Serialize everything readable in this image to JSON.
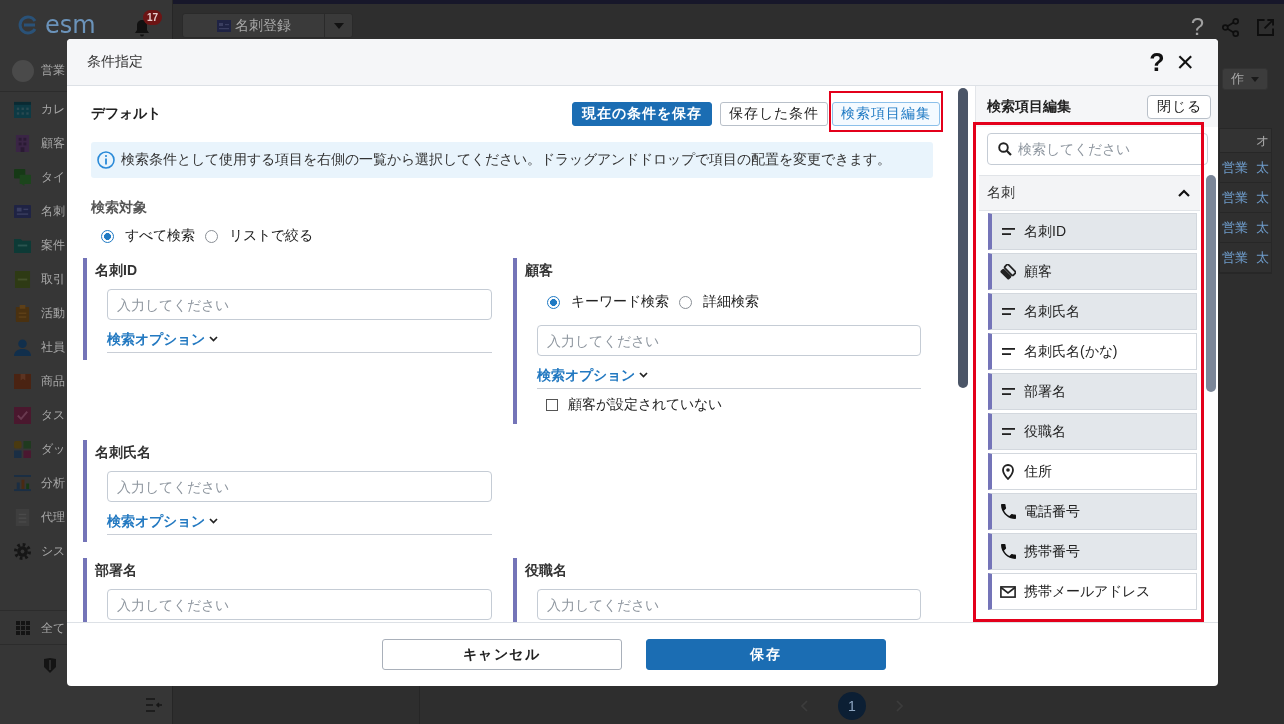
{
  "app": {
    "logo": "esm",
    "notification_count": "17",
    "register_button": "名刺登録",
    "help": "?",
    "sidebar": {
      "user": "営業",
      "items": [
        {
          "label": "カレ",
          "kind": "calendar"
        },
        {
          "label": "顧客",
          "kind": "building"
        },
        {
          "label": "タイ",
          "kind": "chat"
        },
        {
          "label": "名刺",
          "kind": "card"
        },
        {
          "label": "案件",
          "kind": "folder"
        },
        {
          "label": "取引",
          "kind": "ledger"
        },
        {
          "label": "活動",
          "kind": "clipboard"
        },
        {
          "label": "社員",
          "kind": "person"
        },
        {
          "label": "商品",
          "kind": "box"
        },
        {
          "label": "タス",
          "kind": "checkbox"
        },
        {
          "label": "ダッ",
          "kind": "tiles"
        },
        {
          "label": "分析",
          "kind": "chart"
        },
        {
          "label": "代理",
          "kind": "document"
        },
        {
          "label": "シス",
          "kind": "gear"
        }
      ],
      "all_apps": "全て"
    },
    "actions_button": "作",
    "table": {
      "column_2_heading": "オ",
      "rows": [
        [
          "営業",
          "太"
        ],
        [
          "営業",
          "太"
        ],
        [
          "営業",
          "太"
        ],
        [
          "営業",
          "太"
        ]
      ]
    },
    "pagination": [
      {
        "label": "1",
        "selected": true
      }
    ]
  },
  "dialog": {
    "title": "条件指定",
    "help": "?",
    "close": "×",
    "condition_name": "デフォルト",
    "toolbar": [
      {
        "label": "現在の条件を保存",
        "kind": "primary",
        "highlighted": false
      },
      {
        "label": "保存した条件",
        "kind": "outline",
        "highlighted": false
      },
      {
        "label": "検索項目編集",
        "kind": "active",
        "highlighted": true
      }
    ],
    "info": "検索条件として使用する項目を右側の一覧から選択してください。ドラッグアンドドロップで項目の配置を変更できます。",
    "search_target": {
      "label": "検索対象",
      "options": [
        {
          "label": "すべて検索",
          "selected": true
        },
        {
          "label": "リストで絞る",
          "selected": false
        }
      ]
    },
    "field_rows": [
      [
        {
          "label": "名刺ID",
          "placeholder": "入力してください",
          "option_link": "検索オプション"
        },
        {
          "label": "顧客",
          "modes": [
            {
              "label": "キーワード検索",
              "selected": true
            },
            {
              "label": "詳細検索",
              "selected": false
            }
          ],
          "placeholder": "入力してください",
          "option_link": "検索オプション",
          "unset_option": {
            "label": "顧客が設定されていない",
            "checked": false
          }
        }
      ],
      [
        {
          "label": "名刺氏名",
          "placeholder": "入力してください",
          "option_link": "検索オプション"
        }
      ],
      [
        {
          "label": "部署名",
          "placeholder": "入力してください"
        },
        {
          "label": "役職名",
          "placeholder": "入力してください"
        }
      ]
    ],
    "footer": [
      {
        "label": "キャンセル",
        "kind": "secondary"
      },
      {
        "label": "保存",
        "kind": "primary"
      }
    ]
  },
  "field_panel": {
    "title": "検索項目編集",
    "close_button": "閉じる",
    "search_placeholder": "検索してください",
    "highlighted": true,
    "groups": [
      {
        "label": "名刺",
        "expanded": true,
        "items": [
          {
            "label": "名刺ID",
            "kind": "text",
            "added": true
          },
          {
            "label": "顧客",
            "kind": "reference",
            "added": true
          },
          {
            "label": "名刺氏名",
            "kind": "text",
            "added": true
          },
          {
            "label": "名刺氏名(かな)",
            "kind": "text",
            "added": false
          },
          {
            "label": "部署名",
            "kind": "text",
            "added": true
          },
          {
            "label": "役職名",
            "kind": "text",
            "added": true
          },
          {
            "label": "住所",
            "kind": "address",
            "added": false
          },
          {
            "label": "電話番号",
            "kind": "phone",
            "added": true
          },
          {
            "label": "携帯番号",
            "kind": "phone",
            "added": true
          },
          {
            "label": "携帯メールアドレス",
            "kind": "email",
            "added": false
          }
        ]
      }
    ]
  }
}
